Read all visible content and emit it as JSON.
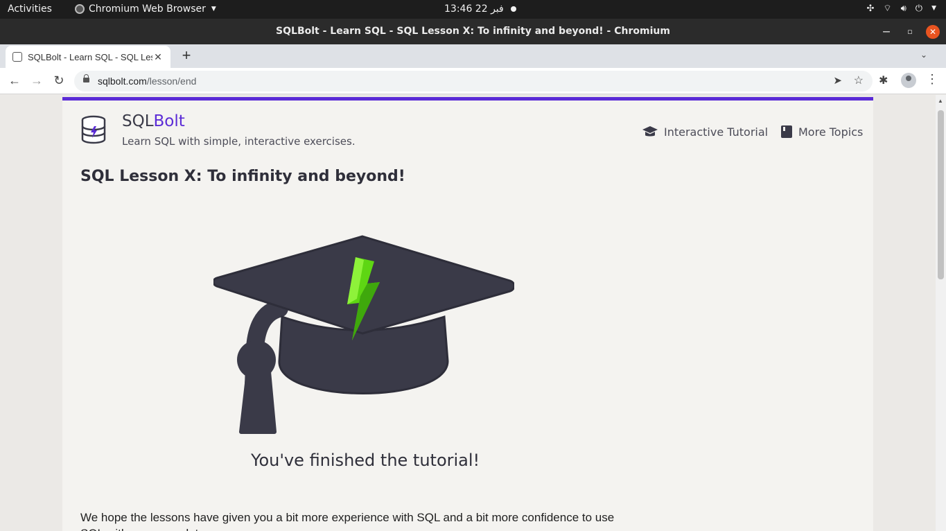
{
  "system_bar": {
    "activities": "Activities",
    "app_name": "Chromium Web Browser",
    "clock": "13:46  22 فبر"
  },
  "window": {
    "title": "SQLBolt - Learn SQL - SQL Lesson X: To infinity and beyond! - Chromium"
  },
  "tabs": [
    {
      "label": "SQLBolt - Learn SQL - SQL Lesson X: To infinity and beyond!"
    }
  ],
  "address_bar": {
    "domain": "sqlbolt.com",
    "path": "/lesson/end"
  },
  "site": {
    "brand_prefix": "SQL",
    "brand_suffix": "Bolt",
    "tagline": "Learn SQL with simple, interactive exercises.",
    "nav": {
      "tutorial": "Interactive Tutorial",
      "topics": "More Topics"
    },
    "accent_color": "#5b2bd6"
  },
  "main": {
    "lesson_title": "SQL Lesson X: To infinity and beyond!",
    "finished_caption": "You've finished the tutorial!",
    "paragraph": "We hope the lessons have given you a bit more experience with SQL and a bit more confidence to use SQL with your own data."
  }
}
